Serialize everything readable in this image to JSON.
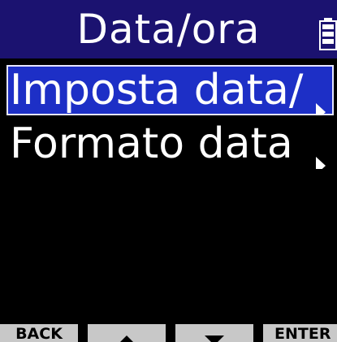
{
  "header": {
    "title": "Data/ora",
    "battery_icon": "battery-icon"
  },
  "menu": {
    "items": [
      {
        "label": "Imposta data/",
        "selected": true,
        "icon": "submenu-arrow-icon"
      },
      {
        "label": "Formato data",
        "selected": false,
        "icon": "submenu-arrow-icon"
      }
    ]
  },
  "softkeys": {
    "back_label": "BACK",
    "up_icon": "up-arrow-icon",
    "down_icon": "down-arrow-icon",
    "enter_label": "ENTER"
  },
  "colors": {
    "title_bar": "#1b1270",
    "selection": "#1d2fc6",
    "background": "#000000",
    "softkey": "#c8c8c8",
    "text": "#ffffff"
  }
}
